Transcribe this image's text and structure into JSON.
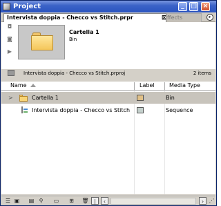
{
  "window": {
    "title": "Project"
  },
  "tabs": [
    {
      "label": "Intervista doppia - Checco vs Stitch.prpr",
      "active": true
    },
    {
      "label": "Effects",
      "active": false
    }
  ],
  "preview": {
    "name": "Cartella 1",
    "type": "Bin"
  },
  "pathbar": {
    "project_file": "Intervista doppia - Checco vs Stitch.prproj",
    "item_count": "2 items"
  },
  "columns": {
    "name": "Name",
    "label": "Label",
    "media_type": "Media Type"
  },
  "items": [
    {
      "name": "Cartella 1",
      "media_type": "Bin",
      "label_color": "#e0c088",
      "icon": "folder-icon",
      "selected": true
    },
    {
      "name": "Intervista doppia - Checco vs Stitch",
      "media_type": "Sequence",
      "label_color": "#c4d0cc",
      "icon": "sequence-icon",
      "selected": false
    }
  ],
  "colors": {
    "titlebar": "#2a54c0",
    "selection": "#c8c4bc"
  }
}
